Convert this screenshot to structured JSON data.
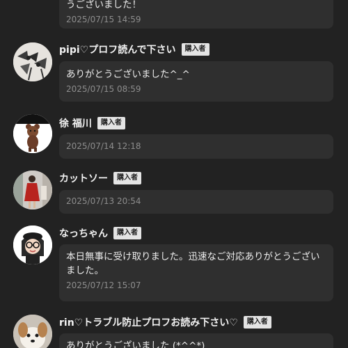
{
  "top_fragment": {
    "message": "うございました！",
    "date": "2025/07/15 14:59"
  },
  "reviews": [
    {
      "username": "pipi♡プロフ読んで下さい",
      "badge": "購入者",
      "message": "ありがとうございました^_^",
      "date": "2025/07/15 08:59",
      "avatar_icon": "ribbon-bows-avatar-icon"
    },
    {
      "username": "徐 福川",
      "badge": "購入者",
      "message": "",
      "date": "2025/07/14 12:18",
      "avatar_icon": "teddy-bear-avatar-icon"
    },
    {
      "username": "カットソー",
      "badge": "購入者",
      "message": "",
      "date": "2025/07/13 20:54",
      "avatar_icon": "red-dress-avatar-icon"
    },
    {
      "username": "なっちゃん",
      "badge": "購入者",
      "message": "本日無事に受け取りました。迅速なご対応ありがとうございました。",
      "date": "2025/07/12 15:07",
      "avatar_icon": "girl-with-glasses-avatar-icon"
    },
    {
      "username": "rin♡トラブル防止プロフお読み下さい♡",
      "badge": "購入者",
      "message": "ありがとうございました (*^^*)",
      "date": "",
      "avatar_icon": "puppy-avatar-icon"
    }
  ],
  "colors": {
    "background": "#222222",
    "bubble": "#2f2f2f",
    "badge": "#e4e4e4",
    "timestamp": "#8d8d8d"
  }
}
